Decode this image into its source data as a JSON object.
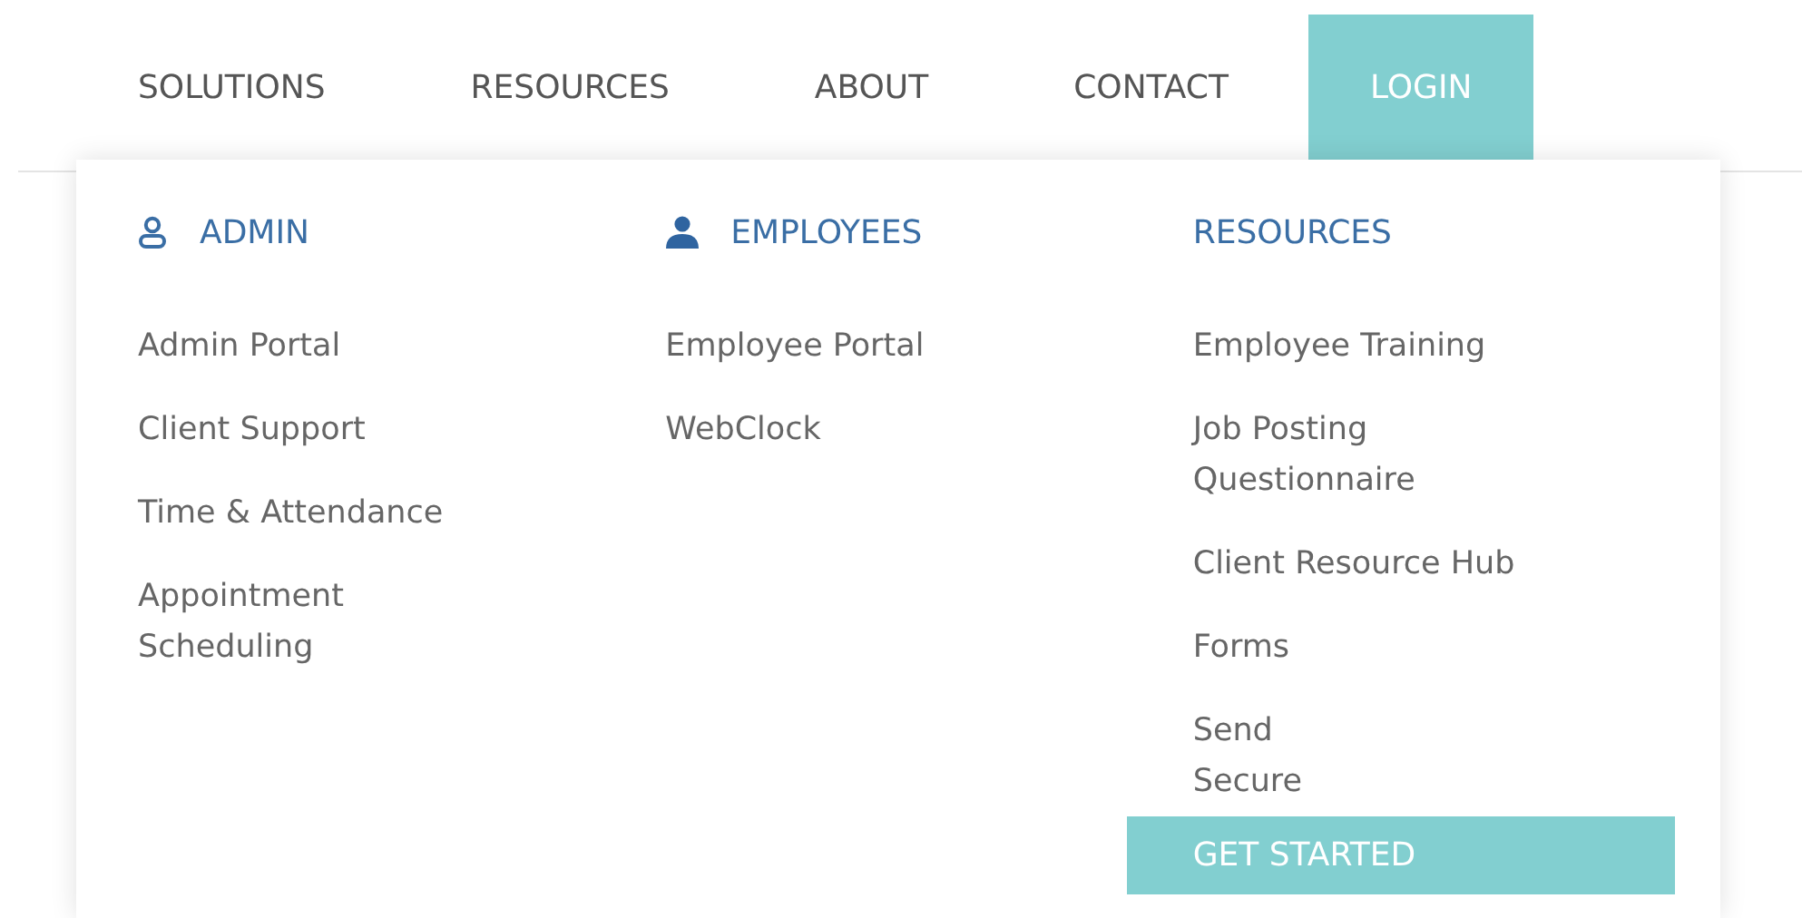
{
  "nav": [
    {
      "label": "SOLUTIONS",
      "selected": false
    },
    {
      "label": "RESOURCES",
      "selected": false
    },
    {
      "label": "ABOUT",
      "selected": false
    },
    {
      "label": "CONTACT",
      "selected": false
    },
    {
      "label": "LOGIN",
      "selected": true
    }
  ],
  "menu": {
    "columns": [
      {
        "heading": "ADMIN",
        "kind": "outline",
        "items": [
          {
            "lines": [
              "Admin Portal"
            ]
          },
          {
            "lines": [
              "Client Support"
            ]
          },
          {
            "lines": [
              "Time & Attendance"
            ]
          },
          {
            "lines": [
              "Appointment",
              "Scheduling"
            ]
          }
        ]
      },
      {
        "heading": "EMPLOYEES",
        "kind": "solid",
        "items": [
          {
            "lines": [
              "Employee Portal"
            ]
          },
          {
            "lines": [
              "WebClock"
            ]
          }
        ]
      },
      {
        "heading": "RESOURCES",
        "kind": "plain",
        "items": [
          {
            "lines": [
              "Employee Training"
            ]
          },
          {
            "lines": [
              "Job Posting",
              "Questionnaire"
            ]
          },
          {
            "lines": [
              "Client Resource Hub"
            ]
          },
          {
            "lines": [
              "Forms"
            ]
          },
          {
            "lines": [
              "Send",
              "Secure"
            ]
          }
        ],
        "button": "GET STARTED"
      }
    ]
  }
}
